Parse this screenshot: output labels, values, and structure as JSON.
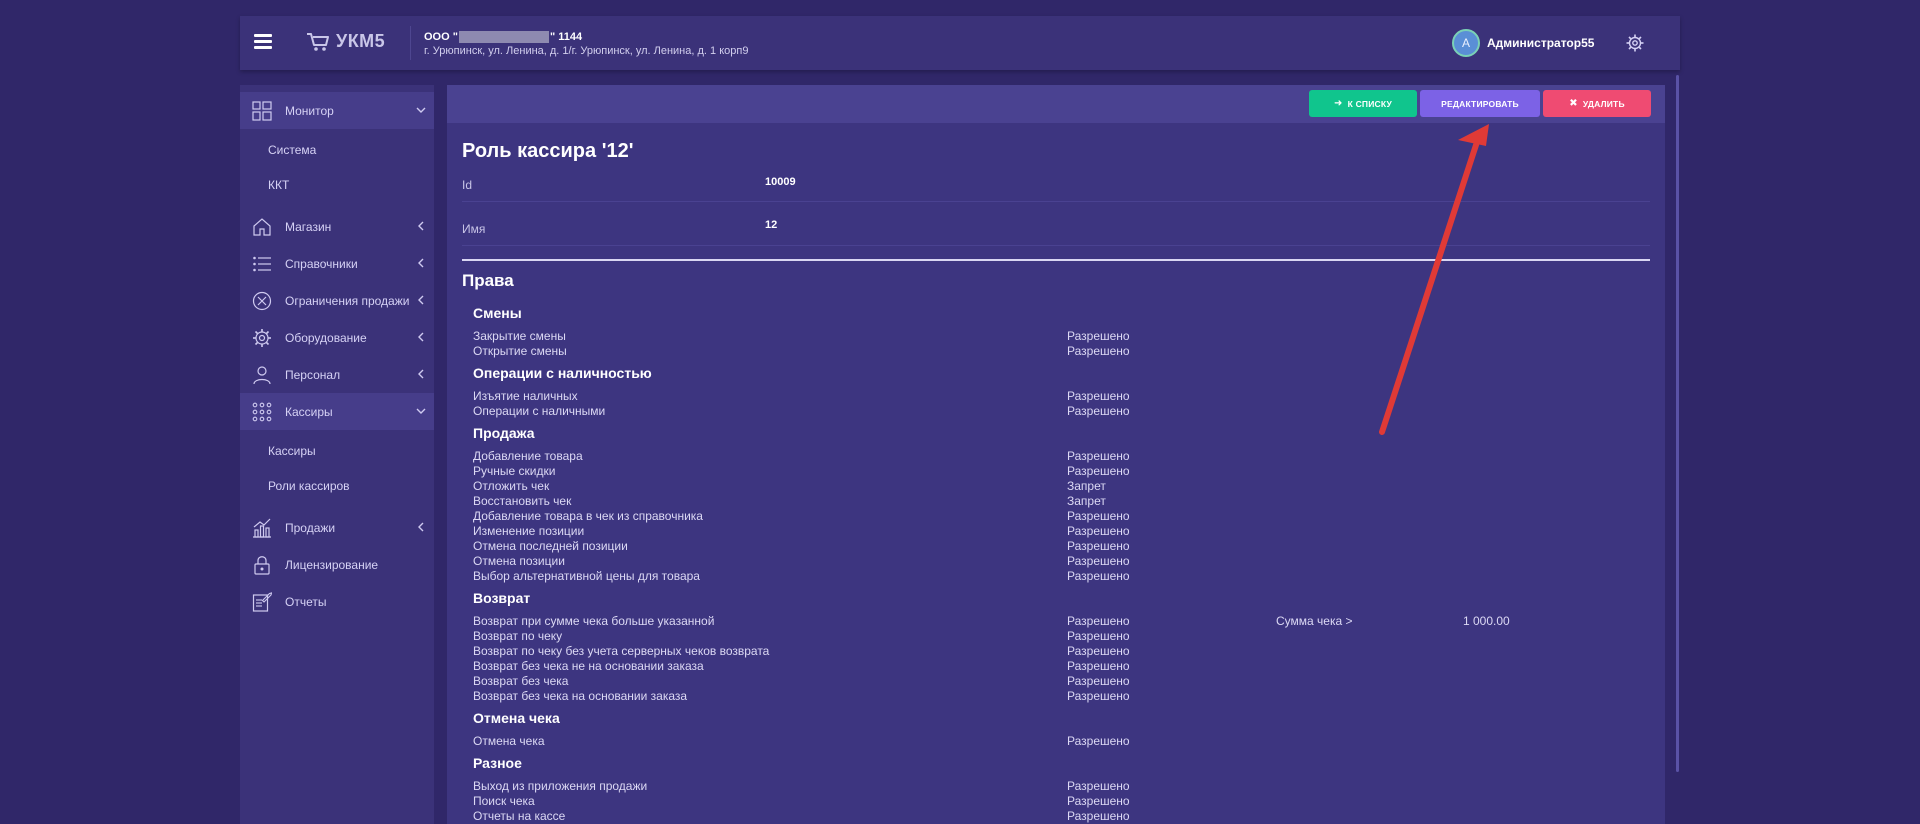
{
  "header": {
    "logo_text": "УКМ5",
    "org_prefix": "ООО \"",
    "org_suffix": "\" 1144",
    "org_address": "г. Урюпинск, ул. Ленина, д. 1/г. Урюпинск, ул. Ленина, д. 1 корп9",
    "avatar_letter": "A",
    "user_name": "Администратор55"
  },
  "sidebar": {
    "items": [
      {
        "label": "Монитор",
        "icon": "grid-icon"
      },
      {
        "label": "Система"
      },
      {
        "label": "ККТ"
      },
      {
        "label": "Магазин",
        "icon": "home-icon"
      },
      {
        "label": "Справочники",
        "icon": "list-icon"
      },
      {
        "label": "Ограничения продажи",
        "icon": "cancel-circle-icon"
      },
      {
        "label": "Оборудование",
        "icon": "gear-icon"
      },
      {
        "label": "Персонал",
        "icon": "person-icon"
      },
      {
        "label": "Кассиры",
        "icon": "dots-grid-icon"
      },
      {
        "label": "Кассиры"
      },
      {
        "label": "Роли кассиров"
      },
      {
        "label": "Продажи",
        "icon": "chart-icon"
      },
      {
        "label": "Лицензирование",
        "icon": "lock-icon"
      },
      {
        "label": "Отчеты",
        "icon": "edit-icon"
      }
    ]
  },
  "actions": {
    "back": "К СПИСКУ",
    "edit": "РЕДАКТИРОВАТЬ",
    "delete": "УДАЛИТЬ"
  },
  "page": {
    "title": "Роль кассира '12'",
    "id_label": "Id",
    "id_value": "10009",
    "name_label": "Имя",
    "name_value": "12",
    "rights_title": "Права"
  },
  "sections": {
    "shifts": {
      "title": "Смены",
      "rows": [
        {
          "label": "Закрытие смены",
          "value": "Разрешено"
        },
        {
          "label": "Открытие смены",
          "value": "Разрешено"
        }
      ]
    },
    "cash": {
      "title": "Операции с наличностью",
      "rows": [
        {
          "label": "Изъятие наличных",
          "value": "Разрешено"
        },
        {
          "label": "Операции с наличными",
          "value": "Разрешено"
        }
      ]
    },
    "sale": {
      "title": "Продажа",
      "rows": [
        {
          "label": "Добавление товара",
          "value": "Разрешено"
        },
        {
          "label": "Ручные скидки",
          "value": "Разрешено"
        },
        {
          "label": "Отложить чек",
          "value": "Запрет"
        },
        {
          "label": "Восстановить чек",
          "value": "Запрет"
        },
        {
          "label": "Добавление товара в чек из справочника",
          "value": "Разрешено"
        },
        {
          "label": "Изменение позиции",
          "value": "Разрешено"
        },
        {
          "label": "Отмена последней позиции",
          "value": "Разрешено"
        },
        {
          "label": "Отмена позиции",
          "value": "Разрешено"
        },
        {
          "label": "Выбор альтернативной цены для товара",
          "value": "Разрешено"
        }
      ]
    },
    "refund": {
      "title": "Возврат",
      "rows": [
        {
          "label": "Возврат при сумме чека больше указанной",
          "value": "Разрешено",
          "extra_label": "Сумма чека >",
          "extra_value": "1 000.00"
        },
        {
          "label": "Возврат по чеку",
          "value": "Разрешено"
        },
        {
          "label": "Возврат по чеку без учета серверных чеков возврата",
          "value": "Разрешено"
        },
        {
          "label": "Возврат без чека не на основании заказа",
          "value": "Разрешено"
        },
        {
          "label": "Возврат без чека",
          "value": "Разрешено"
        },
        {
          "label": "Возврат без чека на основании заказа",
          "value": "Разрешено"
        }
      ]
    },
    "cancel": {
      "title": "Отмена чека",
      "rows": [
        {
          "label": "Отмена чека",
          "value": "Разрешено"
        }
      ]
    },
    "misc": {
      "title": "Разное",
      "rows": [
        {
          "label": "Выход из приложения продажи",
          "value": "Разрешено"
        },
        {
          "label": "Поиск чека",
          "value": "Разрешено"
        },
        {
          "label": "Отчеты на кассе",
          "value": "Разрешено"
        }
      ]
    }
  },
  "colors": {
    "background": "#302769",
    "panel": "#3b3279",
    "content": "#3d3580",
    "btn_back": "#10c58d",
    "btn_edit": "#7c62e6",
    "btn_delete": "#ef4b72",
    "annotation_arrow": "#e03a36"
  }
}
